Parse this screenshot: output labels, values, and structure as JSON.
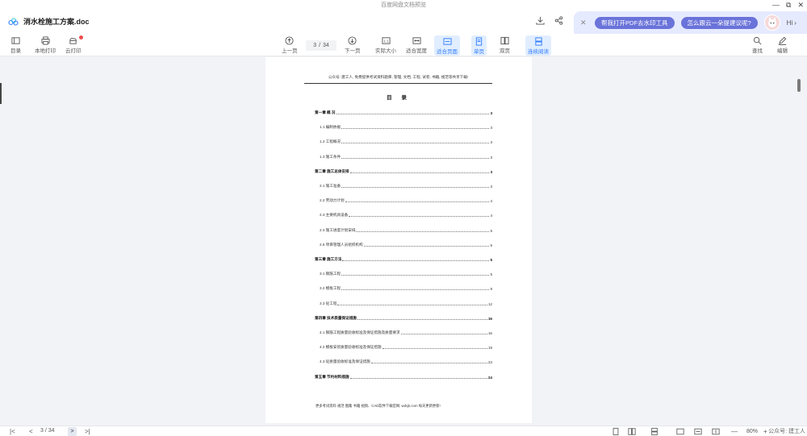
{
  "window": {
    "title": "百度网盘文档预览",
    "controls": [
      "—",
      "⧉",
      "✕"
    ]
  },
  "header": {
    "doc_name": "消水栓施工方案.doc",
    "download_icon": "download-icon",
    "share_icon": "share-icon"
  },
  "ai_assistant": {
    "close": "✕",
    "suggestion_1": "帮我打开PDF去水印工具",
    "suggestion_2": "怎么跟云一朵提建议呢?",
    "greeting": "Hi",
    "accent": "#6a73d9",
    "background": "#e6eaff"
  },
  "toolbar": {
    "toc": "目录",
    "local_print": "本地打印",
    "cloud_print": "云打印",
    "prev_page": "上一页",
    "page_current": "3",
    "page_sep": "/",
    "page_total": "34",
    "next_page": "下一页",
    "actual_size": "实际大小",
    "fit_width": "适合宽度",
    "fit_page": "适合页面",
    "single_page": "单页",
    "double_page": "双页",
    "continuous": "连续阅读",
    "search": "查找",
    "edit": "编辑",
    "active_color": "#2f7bff"
  },
  "document": {
    "header_line": "公众号: 建工人, 免费提供考试资料题库, 管理, 文档, 工程, 试卷, 书籍, 规范等共享下载!",
    "toc_title": "目  录",
    "toc": [
      {
        "label": "第一章   概   况",
        "page": "3",
        "level": "chapter"
      },
      {
        "label": "1.1  编制依据",
        "page": "3",
        "level": "section"
      },
      {
        "label": "1.2  工程概况",
        "page": "3",
        "level": "section"
      },
      {
        "label": "1.3  施工条件",
        "page": "3",
        "level": "section"
      },
      {
        "label": "第二章  施工总体安排",
        "page": "3",
        "level": "chapter"
      },
      {
        "label": "2.1  施工准备",
        "page": "3",
        "level": "section"
      },
      {
        "label": "2.2  劳动力计划",
        "page": "4",
        "level": "section"
      },
      {
        "label": "2.3  主要机具设备",
        "page": "4",
        "level": "section"
      },
      {
        "label": "2.4  施工进度计划安排",
        "page": "5",
        "level": "section"
      },
      {
        "label": "2.5  项目管理人员组织机构",
        "page": "5",
        "level": "section"
      },
      {
        "label": "第三章   施工方法",
        "page": "5",
        "level": "chapter"
      },
      {
        "label": "3.1  钢筋工程",
        "page": "5",
        "level": "section"
      },
      {
        "label": "3.2  模板工程",
        "page": "8",
        "level": "section"
      },
      {
        "label": "3.3  砼工程",
        "page": "12",
        "level": "section"
      },
      {
        "label": "第四章  技术质量保证措施",
        "page": "16",
        "level": "chapter"
      },
      {
        "label": "4.1  钢筋工程质量验收标准及保证措施及质量要求",
        "page": "16",
        "level": "section"
      },
      {
        "label": "4.2  模板安装质量验收标准及保证措施",
        "page": "19",
        "level": "section"
      },
      {
        "label": "4.3  砼质量验收标准及保证措施",
        "page": "23",
        "level": "section"
      },
      {
        "label": "第五章   节约材料措施",
        "page": "24",
        "level": "chapter"
      }
    ],
    "footer_line": "更多考试资料  规范  图集  书籍  视频、CAD软件下载官网: wdcjk.com  每天更新更新!"
  },
  "statusbar": {
    "first": "|<",
    "prev": "<",
    "page_current": "3",
    "page_sep": "/",
    "page_total": "34",
    "next": ">",
    "last": ">|",
    "zoom_out": "—",
    "zoom": "80%",
    "zoom_in": "+",
    "watermark": "公众号: 建工人"
  }
}
